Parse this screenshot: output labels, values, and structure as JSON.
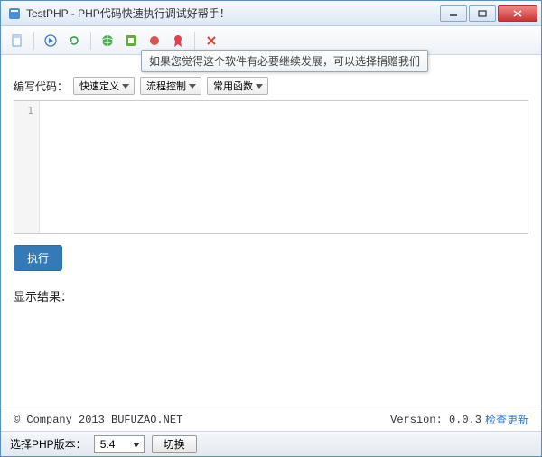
{
  "window": {
    "title": "TestPHP - PHP代码快速执行调试好帮手！"
  },
  "toolbar": {
    "tooltip": "如果您觉得这个软件有必要继续发展，可以选择捐赠我们"
  },
  "editor": {
    "label": "编写代码：",
    "dropdown1": "快速定义",
    "dropdown2": "流程控制",
    "dropdown3": "常用函数",
    "line1": "1",
    "code": ""
  },
  "run": {
    "label": "执行"
  },
  "result": {
    "label": "显示结果："
  },
  "footer": {
    "copyright": "© Company 2013 BUFUZAO.NET",
    "version_label": "Version: 0.0.3",
    "update_link": "检查更新"
  },
  "status": {
    "php_label": "选择PHP版本：",
    "php_value": "5.4",
    "switch_label": "切换"
  }
}
